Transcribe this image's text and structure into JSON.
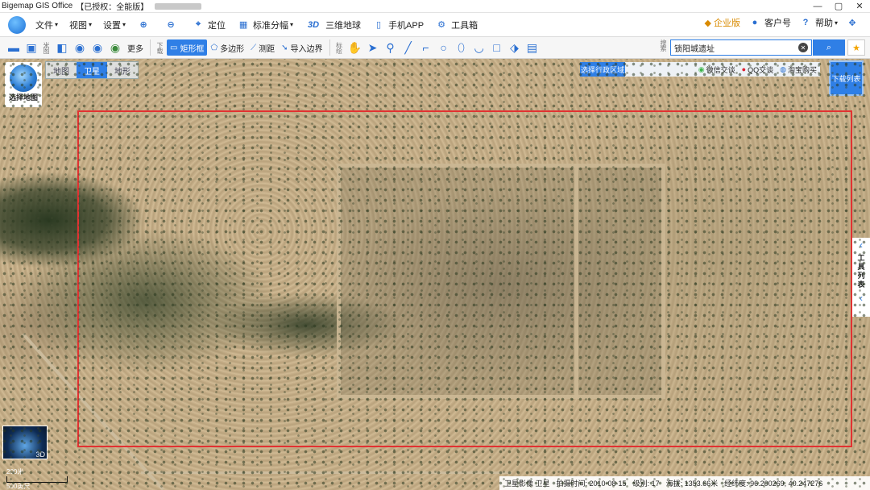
{
  "titlebar": {
    "title": "Bigemap GIS Office",
    "license": "【已授权：全能版】",
    "controls": [
      "—",
      "▢",
      "✕"
    ]
  },
  "menu": {
    "items": [
      "文件",
      "视图",
      "设置"
    ],
    "tools": [
      {
        "icon": "zoom-in-icon",
        "label": ""
      },
      {
        "icon": "zoom-out-icon",
        "label": ""
      },
      {
        "icon": "locate-icon",
        "label": "定位"
      },
      {
        "icon": "grid-icon",
        "label": "标准分幅"
      },
      {
        "icon": "3d-icon",
        "label": "三维地球"
      },
      {
        "icon": "phone-icon",
        "label": "手机APP"
      },
      {
        "icon": "gear-icon",
        "label": "工具箱"
      }
    ],
    "right": {
      "enterprise": "企业版",
      "customer": "客户号",
      "help": "帮助"
    }
  },
  "toolbar": {
    "group1_label": "米图",
    "more": "更多",
    "group2_label": "下载",
    "rect": "矩形框",
    "polygon": "多边形",
    "measure": "测距",
    "import": "导入边界",
    "group3_label": "标绘",
    "search_label": "搜索",
    "search_value": "锁阳城遗址"
  },
  "map": {
    "types": [
      "地图",
      "卫星",
      "地形"
    ],
    "active_type": "卫星",
    "select_map": "选择地图",
    "region": "选择行政区域",
    "contact": {
      "wechat": "微信交谈",
      "qq": "QQ交谈",
      "taobao": "淘宝购买"
    },
    "download_list": "下载列表",
    "tool_list": "工具列表",
    "minimap_label": "3D",
    "scale": {
      "m": "200米",
      "ft": "500英尺"
    },
    "status": {
      "source": "卫星影像 卫星",
      "shot_time": "拍摄时间: 2010-08-15",
      "level": "级别: 17",
      "altitude": "海拔: 1353.66米",
      "coords": "经纬度: 96.200269, 40.247276"
    }
  },
  "colors": {
    "accent": "#2f7fe6",
    "selection": "#e23232"
  }
}
